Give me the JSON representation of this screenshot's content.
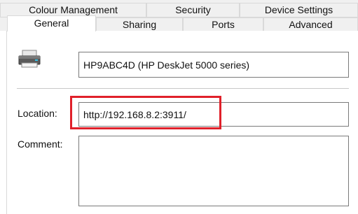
{
  "tabs": {
    "row_back": [
      {
        "label": "Colour Management"
      },
      {
        "label": "Security"
      },
      {
        "label": "Device Settings"
      }
    ],
    "row_front": [
      {
        "label": "General"
      },
      {
        "label": "Sharing"
      },
      {
        "label": "Ports"
      },
      {
        "label": "Advanced"
      }
    ],
    "active": "General"
  },
  "general": {
    "printer_icon": "printer-icon",
    "printer_name": "HP9ABC4D (HP DeskJet 5000 series)",
    "location_label": "Location:",
    "location_value": "http://192.168.8.2:3911/",
    "comment_label": "Comment:",
    "comment_value": ""
  },
  "colors": {
    "highlight": "#e0202a",
    "tab_background": "#f0f0f0",
    "field_border": "#7a7a7a"
  }
}
